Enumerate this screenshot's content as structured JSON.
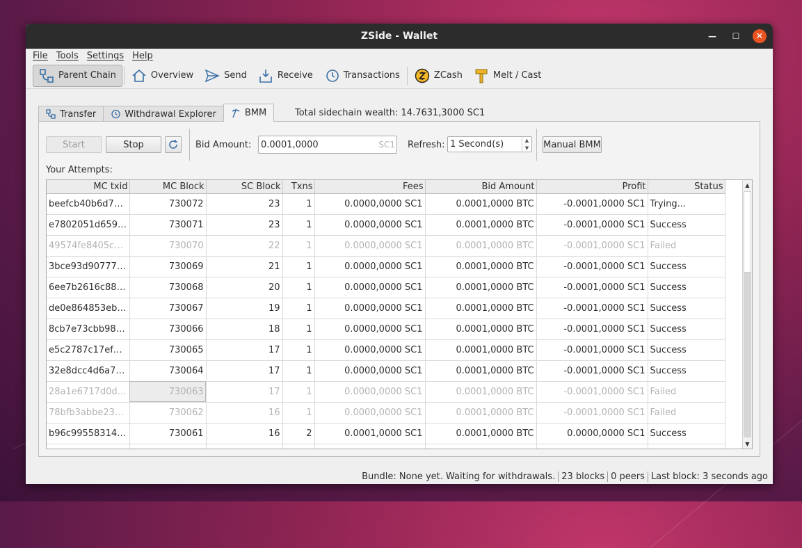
{
  "window": {
    "title": "ZSide - Wallet"
  },
  "menu": [
    "File",
    "Tools",
    "Settings",
    "Help"
  ],
  "toolbar": {
    "parent_chain": "Parent Chain",
    "overview": "Overview",
    "send": "Send",
    "receive": "Receive",
    "transactions": "Transactions",
    "zcash": "ZCash",
    "melt_cast": "Melt / Cast"
  },
  "tabs": {
    "transfer": "Transfer",
    "withdrawal_explorer": "Withdrawal Explorer",
    "bmm": "BMM"
  },
  "wealth_text": "Total sidechain wealth: 14.7631,3000 SC1",
  "bmm": {
    "start_label": "Start",
    "stop_label": "Stop",
    "bid_label": "Bid Amount:",
    "bid_value": "0.0001,0000",
    "bid_unit": "SC1",
    "refresh_label": "Refresh:",
    "refresh_value": "1 Second(s)",
    "manual_label": "Manual BMM",
    "attempts_label": "Your Attempts:"
  },
  "table": {
    "columns": [
      "MC txid",
      "MC Block",
      "SC Block",
      "Txns",
      "Fees",
      "Bid Amount",
      "Profit",
      "Status"
    ],
    "rows": [
      [
        "beefcb40b6d77...",
        "730072",
        "23",
        "1",
        "0.0000,0000 SC1",
        "0.0001,0000 BTC",
        "-0.0001,0000 SC1",
        "Trying..."
      ],
      [
        "e7802051d659a...",
        "730071",
        "23",
        "1",
        "0.0000,0000 SC1",
        "0.0001,0000 BTC",
        "-0.0001,0000 SC1",
        "Success"
      ],
      [
        "49574fe8405cc...",
        "730070",
        "22",
        "1",
        "0.0000,0000 SC1",
        "0.0001,0000 BTC",
        "-0.0001,0000 SC1",
        "Failed"
      ],
      [
        "3bce93d907777...",
        "730069",
        "21",
        "1",
        "0.0000,0000 SC1",
        "0.0001,0000 BTC",
        "-0.0001,0000 SC1",
        "Success"
      ],
      [
        "6ee7b2616c888...",
        "730068",
        "20",
        "1",
        "0.0000,0000 SC1",
        "0.0001,0000 BTC",
        "-0.0001,0000 SC1",
        "Success"
      ],
      [
        "de0e864853eb1...",
        "730067",
        "19",
        "1",
        "0.0000,0000 SC1",
        "0.0001,0000 BTC",
        "-0.0001,0000 SC1",
        "Success"
      ],
      [
        "8cb7e73cbb98b...",
        "730066",
        "18",
        "1",
        "0.0000,0000 SC1",
        "0.0001,0000 BTC",
        "-0.0001,0000 SC1",
        "Success"
      ],
      [
        "e5c2787c17ef5c...",
        "730065",
        "17",
        "1",
        "0.0000,0000 SC1",
        "0.0001,0000 BTC",
        "-0.0001,0000 SC1",
        "Success"
      ],
      [
        "32e8dcc4d6a72f...",
        "730064",
        "17",
        "1",
        "0.0000,0000 SC1",
        "0.0001,0000 BTC",
        "-0.0001,0000 SC1",
        "Success"
      ],
      [
        "28a1e6717d0d2...",
        "730063",
        "17",
        "1",
        "0.0000,0000 SC1",
        "0.0001,0000 BTC",
        "-0.0001,0000 SC1",
        "Failed"
      ],
      [
        "78bfb3abbe235...",
        "730062",
        "16",
        "1",
        "0.0000,0000 SC1",
        "0.0001,0000 BTC",
        "-0.0001,0000 SC1",
        "Failed"
      ],
      [
        "b96c99558314a...",
        "730061",
        "16",
        "2",
        "0.0001,0000 SC1",
        "0.0001,0000 BTC",
        "0.0000,0000 SC1",
        "Success"
      ],
      [
        "",
        "",
        "",
        "",
        "",
        "",
        "",
        ""
      ]
    ]
  },
  "status_bar": {
    "bundle": "Bundle: None yet. Waiting for withdrawals.",
    "blocks": "23 blocks",
    "peers": "0 peers",
    "last_block": "Last block: 3 seconds ago"
  },
  "colors": {
    "close_button": "#e95420",
    "titlebar": "#2c2c2c",
    "failed_text": "#b3b3b3"
  }
}
